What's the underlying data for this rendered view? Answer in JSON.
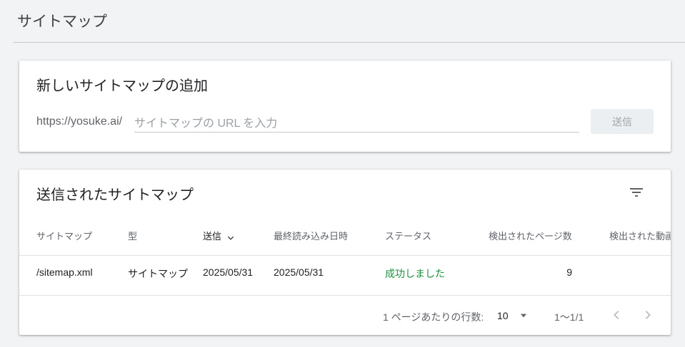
{
  "page": {
    "title": "サイトマップ"
  },
  "add_card": {
    "title": "新しいサイトマップの追加",
    "url_prefix": "https://yosuke.ai/",
    "input_placeholder": "サイトマップの URL を入力",
    "input_value": "",
    "submit_label": "送信"
  },
  "submitted_card": {
    "title": "送信されたサイトマップ",
    "columns": [
      "サイトマップ",
      "型",
      "送信",
      "最終読み込み日時",
      "ステータス",
      "検出されたページ数",
      "検出された動画数"
    ],
    "sorted_column": "送信",
    "rows": [
      {
        "sitemap": "/sitemap.xml",
        "type": "サイトマップ",
        "submitted": "2025/05/31",
        "last_read": "2025/05/31",
        "status": "成功しました",
        "pages": "9",
        "videos": ""
      }
    ]
  },
  "pagination": {
    "rows_per_page_label": "1 ページあたりの行数:",
    "rows_per_page": "10",
    "range": "1〜1/1"
  },
  "icons": {
    "filter": "filter-icon",
    "sort_arrow": "arrow-down-icon",
    "dropdown": "dropdown-icon",
    "prev": "chevron-left-icon",
    "next": "chevron-right-icon"
  },
  "colors": {
    "background": "#f1f3f4",
    "status_success": "#1e8e3e",
    "disabled_button_bg": "#eceff1"
  }
}
